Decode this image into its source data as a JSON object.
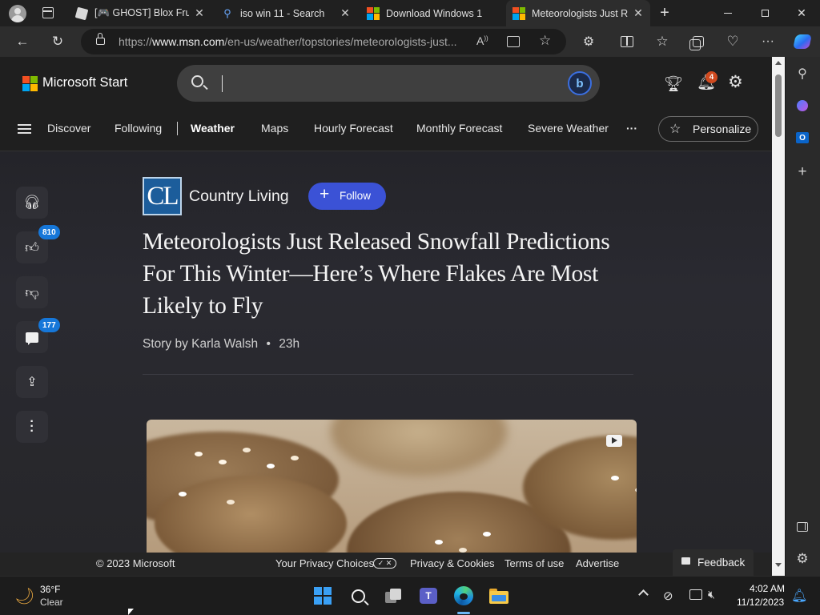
{
  "tabs": [
    {
      "label": "[🎮 GHOST] Blox Frui"
    },
    {
      "label": "iso win 11 - Search"
    },
    {
      "label": "Download Windows 1"
    },
    {
      "label": "Meteorologists Just R"
    }
  ],
  "address_bar": {
    "url_prefix": "https://",
    "url_domain": "www.msn.com",
    "url_path": "/en-us/weather/topstories/meteorologists-just..."
  },
  "msn_header": {
    "brand": "Microsoft Start",
    "notification_count": "4"
  },
  "nav": {
    "items": [
      "Discover",
      "Following",
      "Weather",
      "Maps",
      "Hourly Forecast",
      "Monthly Forecast",
      "Severe Weather"
    ],
    "more": "···",
    "personalize": "Personalize"
  },
  "rail": {
    "like_count": "810",
    "comment_count": "177"
  },
  "article": {
    "publisher_logo": "CL",
    "publisher": "Country Living",
    "follow": "Follow",
    "headline": "Meteorologists Just Released Snowfall Predictions For This Winter—Here’s Where Flakes Are Most Likely to Fly",
    "byline": "Story by Karla Walsh",
    "byline_sep": "•",
    "age": "23h"
  },
  "footer": {
    "copyright": "© 2023 Microsoft",
    "privacy_choices": "Your Privacy Choices",
    "privacy_cookies": "Privacy & Cookies",
    "terms": "Terms of use",
    "advertise": "Advertise",
    "feedback": "Feedback"
  },
  "taskbar": {
    "weather_temp": "36°F",
    "weather_desc": "Clear",
    "time": "4:02 AM",
    "date": "11/12/2023"
  },
  "colors": {
    "accent_blue": "#3b52d6",
    "badge_blue": "#1677d9",
    "notification_badge": "#d04a1f",
    "publisher_logo_bg": "#1c5d9b"
  }
}
